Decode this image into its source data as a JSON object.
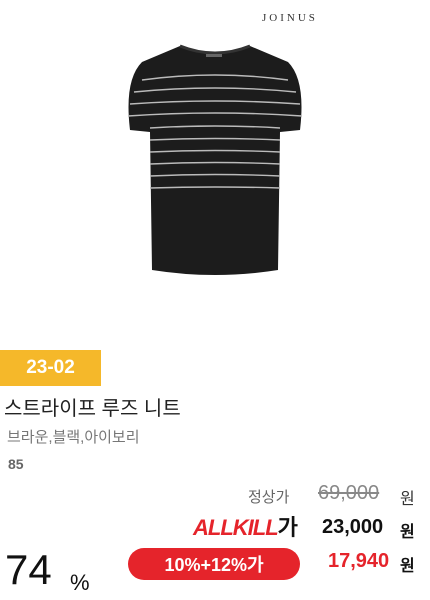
{
  "brand": {
    "logo_text": "JOINUS"
  },
  "product": {
    "image_icon": "striped-knit-top-illustration",
    "code_badge": "23-02",
    "name": "스트라이프 루즈 니트",
    "colors": "브라운,블랙,아이보리",
    "review_count": "85"
  },
  "pricing": {
    "regular_label": "정상가",
    "regular_price": "69,000",
    "regular_unit": "원",
    "allkill_label_main": "ALLKILL",
    "allkill_label_suffix": "가",
    "allkill_price": "23,000",
    "allkill_unit": "원",
    "discount_rate": "74",
    "discount_unit": "%",
    "coupon_label": "10%+12%가",
    "final_price": "17,940",
    "final_unit": "원"
  },
  "colors": {
    "badge_yellow": "#f5b82a",
    "accent_red": "#e5242b"
  }
}
